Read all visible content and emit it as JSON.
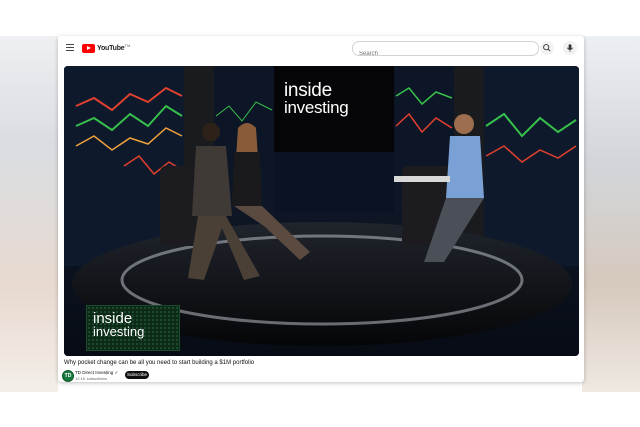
{
  "masthead": {
    "logo_text": "YouTube",
    "logo_tm": "TM",
    "search_placeholder": "Search"
  },
  "video": {
    "banner_line1": "inside",
    "banner_line2": "investing",
    "lower_third_line1": "inside",
    "lower_third_line2": "investing",
    "title": "Why pocket change can be all you need to start building a $1M portfolio"
  },
  "channel": {
    "avatar_text": "TD",
    "name": "TD Direct Investing ✓",
    "subscribers": "12.1K subscribers",
    "subscribe_label": "Subscribe"
  },
  "colors": {
    "brand_red": "#ff0000",
    "channel_green": "#1a7a3d",
    "subscribe_bg": "#0f0f0f"
  }
}
